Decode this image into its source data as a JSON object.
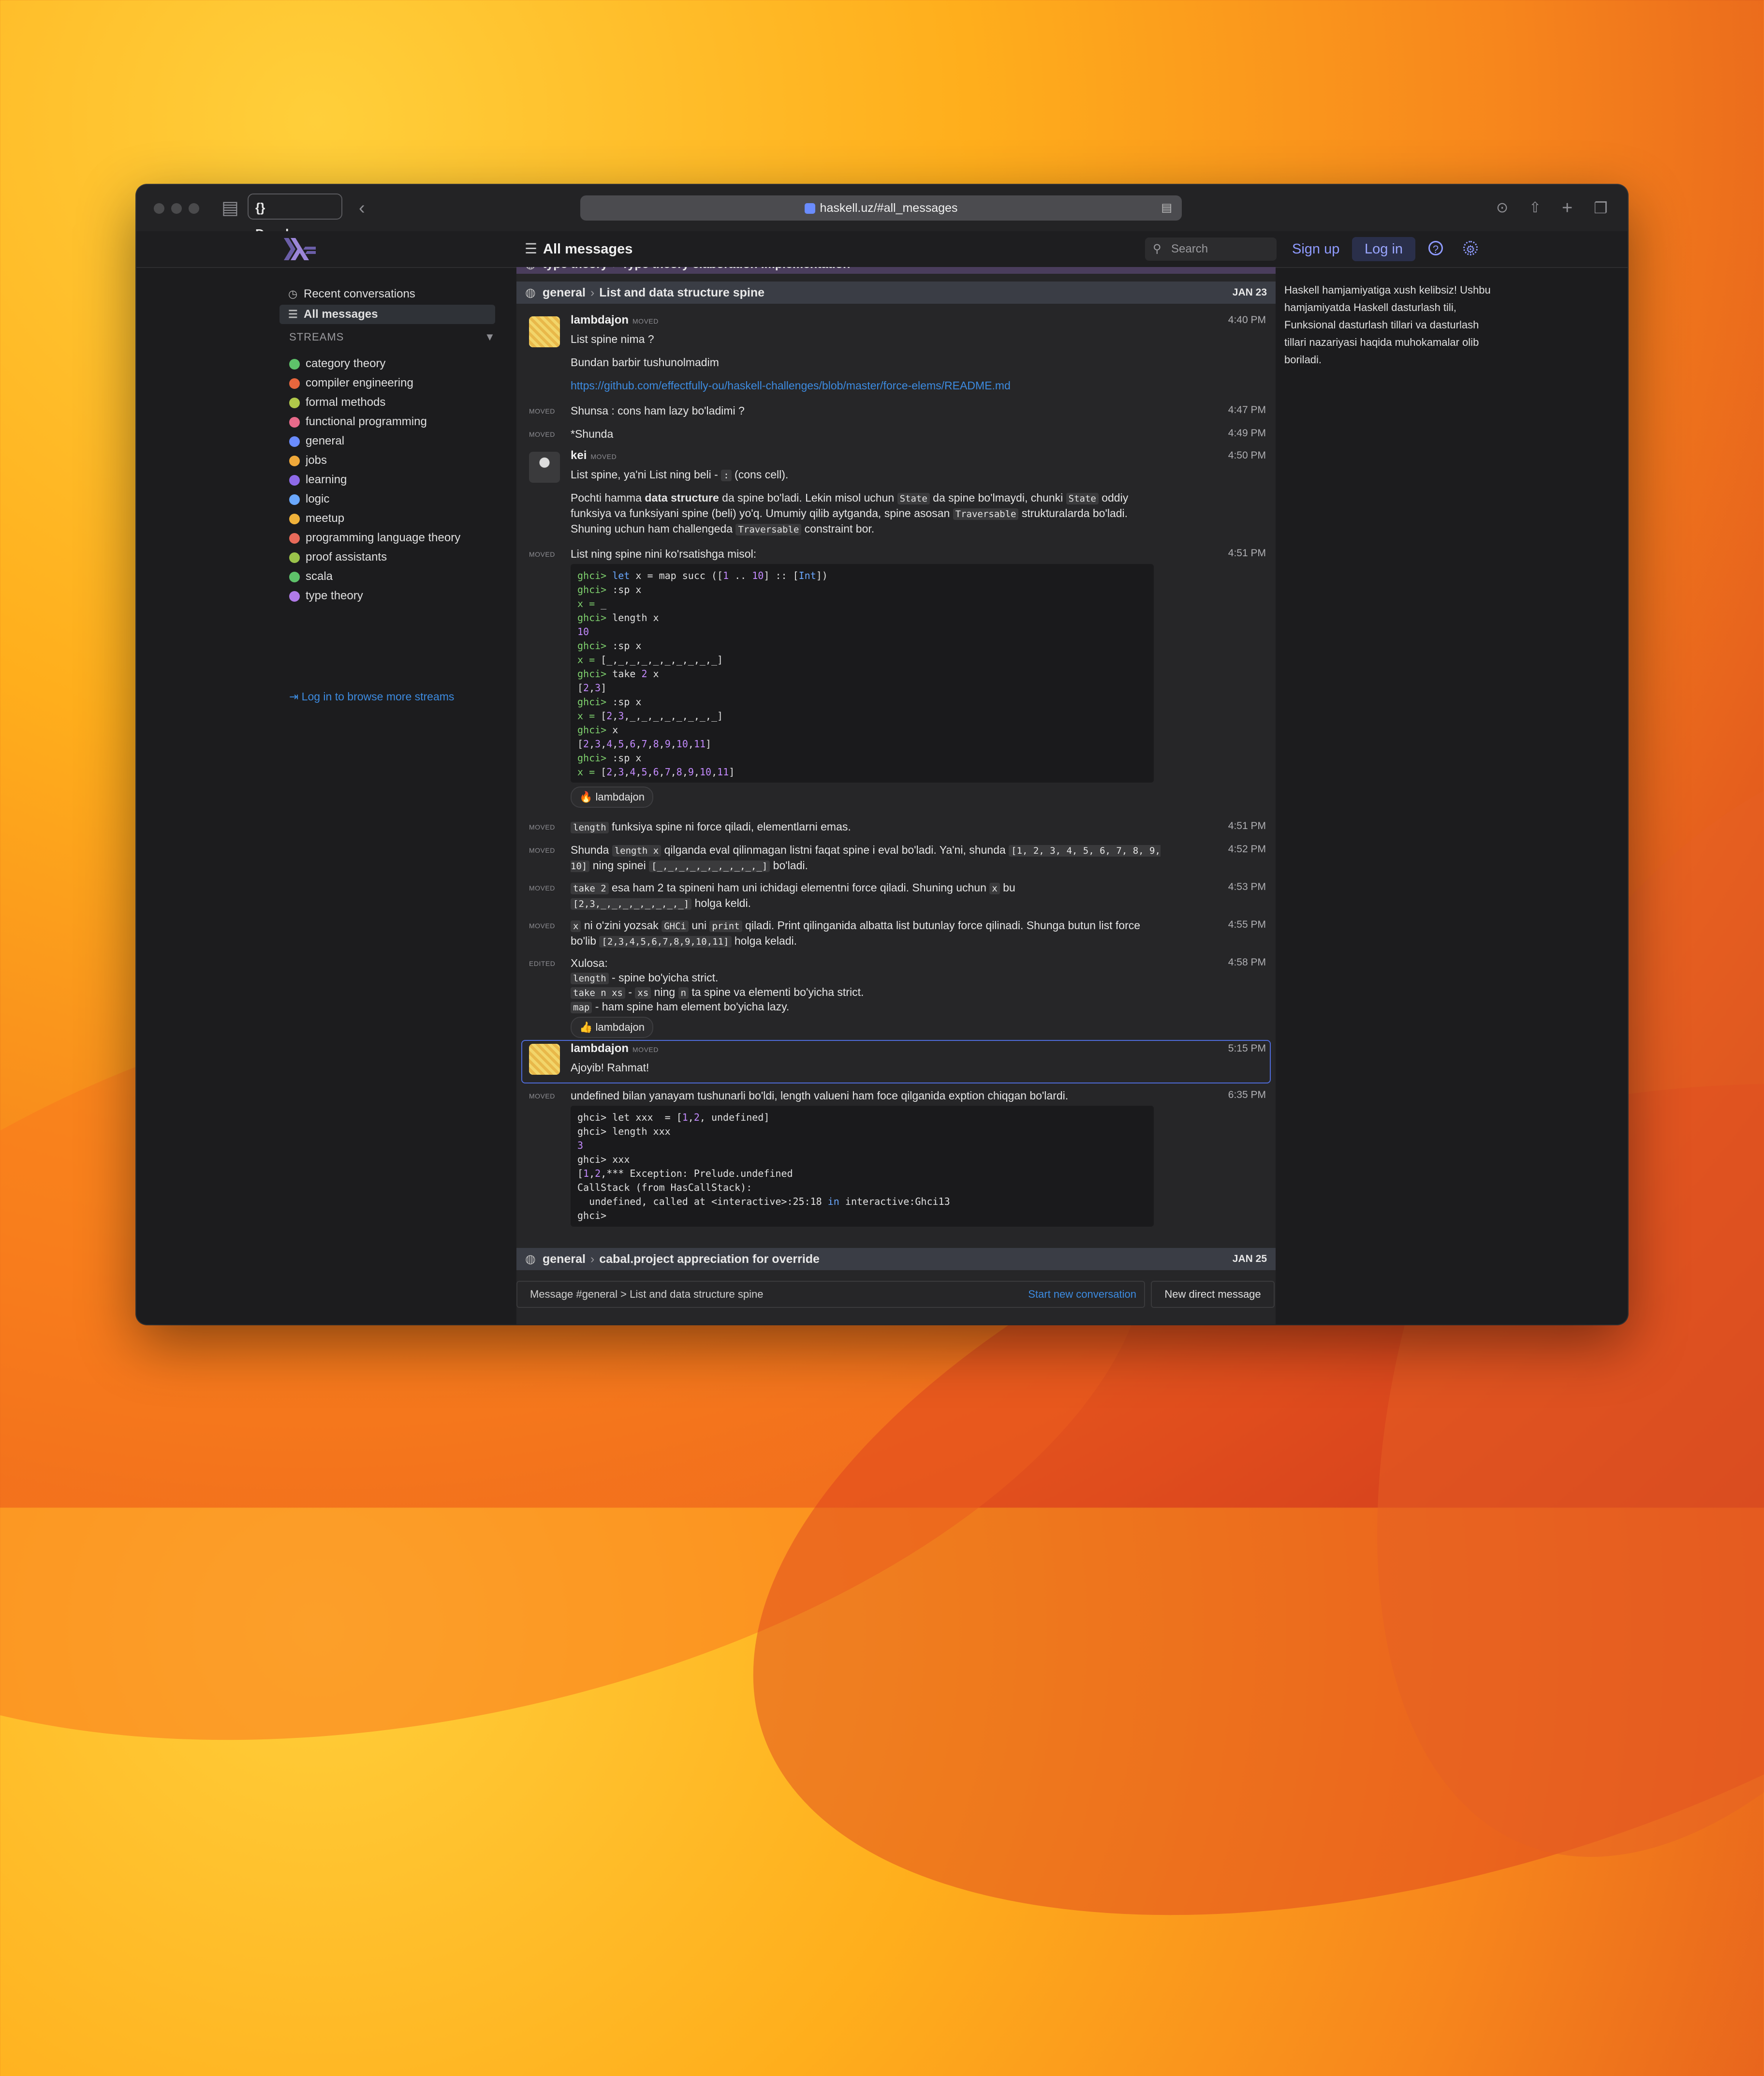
{
  "browser": {
    "dev_label": "{} Developer",
    "url": "haskell.uz/#all_messages"
  },
  "header": {
    "title": "All messages",
    "search_placeholder": "Search",
    "signup": "Sign up",
    "login": "Log in"
  },
  "sidebar": {
    "recent": "Recent conversations",
    "all_messages": "All messages",
    "streams_heading": "STREAMS",
    "streams": [
      {
        "name": "category theory",
        "color": "#5ec26a"
      },
      {
        "name": "compiler engineering",
        "color": "#e8663d"
      },
      {
        "name": "formal methods",
        "color": "#b0c84a"
      },
      {
        "name": "functional programming",
        "color": "#e86a8a"
      },
      {
        "name": "general",
        "color": "#6a8cff"
      },
      {
        "name": "jobs",
        "color": "#f0a93a"
      },
      {
        "name": "learning",
        "color": "#8e6ae8"
      },
      {
        "name": "logic",
        "color": "#6aa8ff"
      },
      {
        "name": "meetup",
        "color": "#f0b23a"
      },
      {
        "name": "programming language theory",
        "color": "#e86a5a"
      },
      {
        "name": "proof assistants",
        "color": "#9ac24a"
      },
      {
        "name": "scala",
        "color": "#5ec26a"
      },
      {
        "name": "type theory",
        "color": "#b07ae8"
      }
    ],
    "browse_more": "Log in to browse more streams"
  },
  "feed": {
    "prev_topic": {
      "stream": "type theory",
      "topic": "Type theory elaboration implementation"
    },
    "topic1": {
      "stream": "general",
      "topic": "List and data structure spine",
      "date": "JAN 23"
    },
    "topic2": {
      "stream": "general",
      "topic": "cabal.project appreciation for override",
      "date": "JAN 25"
    },
    "moved": "MOVED",
    "edited": "EDITED",
    "m1": {
      "sender": "lambdajon",
      "time": "4:40 PM",
      "line1": "List spine nima ?",
      "line2": "Bundan barbir tushunolmadim",
      "link": "https://github.com/effectfully-ou/haskell-challenges/blob/master/force-elems/README.md"
    },
    "m2": {
      "time": "4:47 PM",
      "text": "Shunsa : cons ham lazy bo'ladimi ?"
    },
    "m3": {
      "time": "4:49 PM",
      "text": "*Shunda"
    },
    "m4": {
      "sender": "kei",
      "time": "4:50 PM"
    },
    "m5": {
      "time": "4:51 PM",
      "text": "List ning spine nini ko'rsatishga misol:"
    },
    "reaction1": "🔥 lambdajon",
    "m6": {
      "time": "4:51 PM"
    },
    "m7": {
      "time": "4:52 PM"
    },
    "m8": {
      "time": "4:53 PM"
    },
    "m9": {
      "time": "4:55 PM"
    },
    "m10": {
      "time": "4:58 PM",
      "line1": "Xulosa:"
    },
    "reaction2": "👍 lambdajon",
    "m11": {
      "sender": "lambdajon",
      "time": "5:15 PM",
      "text": "Ajoyib! Rahmat!"
    },
    "m12": {
      "time": "6:35 PM",
      "text": "undefined bilan yanayam tushunarli bo'ldi, length valueni ham foce qilganida exption chiqgan bo'lardi."
    }
  },
  "composer": {
    "placeholder": "Message #general > List and data structure spine",
    "start_new": "Start new conversation",
    "new_dm": "New direct message"
  },
  "right_sidebar": {
    "welcome": "Haskell hamjamiyatiga xush kelibsiz! Ushbu hamjamiyatda Haskell dasturlash tili, Funksional dasturlash tillari va dasturlash tillari nazariyasi haqida muhokamalar olib boriladi."
  }
}
